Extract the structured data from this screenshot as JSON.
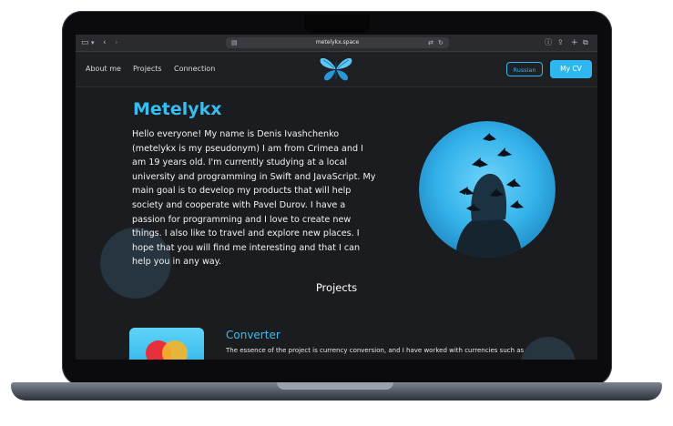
{
  "browser": {
    "url": "metelykx.space",
    "icons": [
      "sidebar-icon",
      "chevron-down-icon",
      "back-icon",
      "forward-icon",
      "page-icon",
      "translate-icon",
      "reload-icon",
      "download-icon",
      "share-icon",
      "new-tab-icon",
      "tabs-icon"
    ]
  },
  "nav": {
    "links": [
      "About me",
      "Projects",
      "Connection"
    ],
    "lang_button": "Russian",
    "cv_button": "My CV",
    "logo_icon": "butterfly-icon"
  },
  "hero": {
    "name": "Metelykx",
    "bio": "Hello everyone! My name is Denis Ivashchenko (metelykx is my pseudonym) I am from Crimea and I am 19 years old. I'm currently studying at a local university and programming in Swift and JavaScript. My main goal is to develop my products that will help society and cooperate with Pavel Durov. I have a passion for programming and I love to create new things. I also like to travel and explore new places. I hope that you will find me interesting and that I can help you in any way."
  },
  "projects": {
    "heading": "Projects",
    "items": [
      {
        "title": "Converter",
        "description": "The essence of the project is currency conversion, and I have worked with currencies such as"
      }
    ]
  },
  "colors": {
    "accent": "#38bdf0",
    "background": "#1b1c1f",
    "text": "#f2f2f2"
  }
}
